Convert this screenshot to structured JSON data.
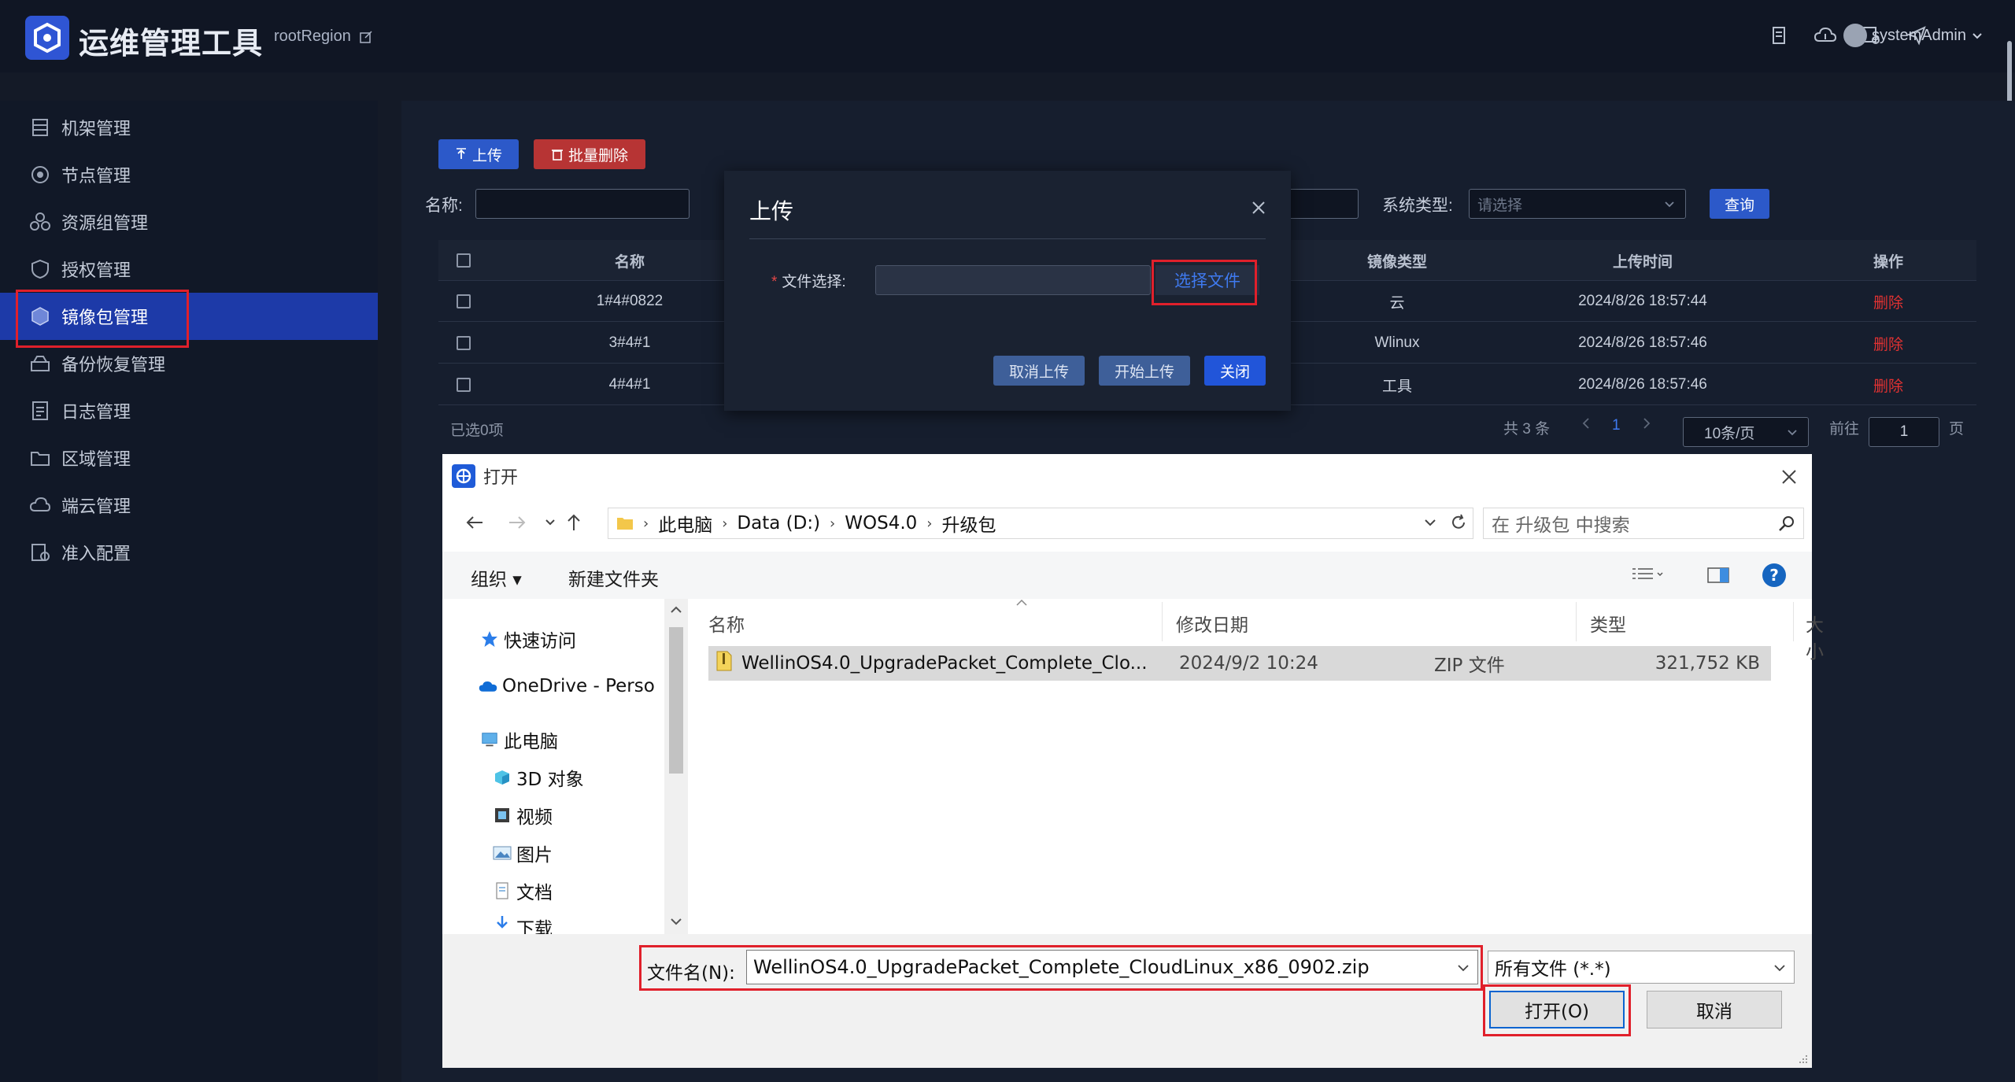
{
  "header": {
    "app_title": "运维管理工具",
    "region": "rootRegion",
    "user": "systemAdmin"
  },
  "sidebar": {
    "items": [
      {
        "label": "机架管理",
        "icon": "rack-icon"
      },
      {
        "label": "节点管理",
        "icon": "node-icon"
      },
      {
        "label": "资源组管理",
        "icon": "resource-group-icon"
      },
      {
        "label": "授权管理",
        "icon": "shield-icon"
      },
      {
        "label": "镜像包管理",
        "icon": "image-package-icon",
        "active": true
      },
      {
        "label": "备份恢复管理",
        "icon": "backup-icon"
      },
      {
        "label": "日志管理",
        "icon": "log-icon"
      },
      {
        "label": "区域管理",
        "icon": "region-icon"
      },
      {
        "label": "端云管理",
        "icon": "cloud-icon"
      },
      {
        "label": "准入配置",
        "icon": "admission-icon"
      }
    ]
  },
  "toolbar": {
    "upload_label": "上传",
    "batch_delete_label": "批量删除"
  },
  "filters": {
    "name_label": "名称:",
    "system_type_label": "系统类型:",
    "system_type_placeholder": "请选择",
    "query_label": "查询"
  },
  "table": {
    "headers": {
      "name": "名称",
      "image_type": "镜像类型",
      "upload_time": "上传时间",
      "actions": "操作"
    },
    "rows": [
      {
        "name": "1#4#0822",
        "image_type": "云",
        "upload_time": "2024/8/26 18:57:44",
        "action": "删除"
      },
      {
        "name": "3#4#1",
        "image_type": "Wlinux",
        "upload_time": "2024/8/26 18:57:46",
        "action": "删除"
      },
      {
        "name": "4#4#1",
        "image_type": "工具",
        "upload_time": "2024/8/26 18:57:46",
        "action": "删除"
      }
    ],
    "selected_text": "已选0项"
  },
  "pagination": {
    "total": "共 3 条",
    "current_page": "1",
    "page_size": "10条/页",
    "goto_label": "前往",
    "goto_value": "1",
    "page_suffix": "页"
  },
  "upload_modal": {
    "title": "上传",
    "file_label": "文件选择:",
    "choose_file": "选择文件",
    "cancel_upload": "取消上传",
    "start_upload": "开始上传",
    "close": "关闭"
  },
  "open_dialog": {
    "title": "打开",
    "breadcrumb": [
      "此电脑",
      "Data (D:)",
      "WOS4.0",
      "升级包"
    ],
    "search_placeholder": "在 升级包 中搜索",
    "organize": "组织 ▾",
    "new_folder": "新建文件夹",
    "nav": {
      "quick_access": "快速访问",
      "onedrive": "OneDrive - Perso",
      "this_pc": "此电脑",
      "objects_3d": "3D 对象",
      "videos": "视频",
      "pictures": "图片",
      "documents": "文档",
      "downloads": "下载"
    },
    "columns": {
      "name": "名称",
      "modified": "修改日期",
      "type": "类型",
      "size": "大小"
    },
    "file": {
      "name": "WellinOS4.0_UpgradePacket_Complete_Clo...",
      "modified": "2024/9/2 10:24",
      "type": "ZIP 文件",
      "size": "321,752 KB"
    },
    "filename_label": "文件名(N):",
    "filename_value": "WellinOS4.0_UpgradePacket_Complete_CloudLinux_x86_0902.zip",
    "file_type_filter": "所有文件 (*.*)",
    "open_button": "打开(O)",
    "cancel_button": "取消"
  },
  "colors": {
    "accent": "#2c59c9",
    "active_nav": "#1d3aa8",
    "danger": "#e23232",
    "highlight_box": "#e0202b"
  }
}
